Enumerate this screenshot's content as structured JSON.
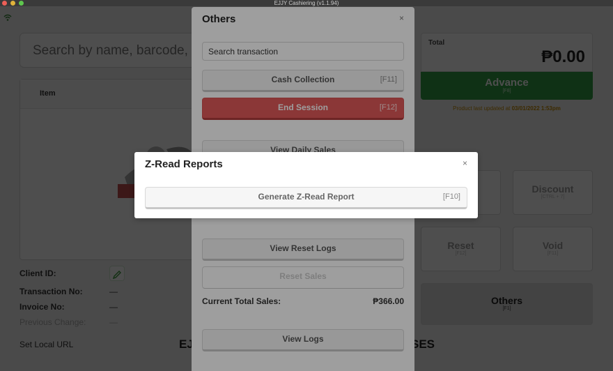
{
  "window": {
    "title": "EJJY Cashiering (v1.1.94)"
  },
  "main": {
    "search_placeholder": "Search by name, barcode, te",
    "table_header_item": "Item",
    "client_id_label": "Client ID:",
    "transaction_no_label": "Transaction No:",
    "transaction_no_value": "—",
    "invoice_no_label": "Invoice No:",
    "invoice_no_value": "—",
    "previous_change_label": "Previous Change:",
    "previous_change_value": "—",
    "set_local_url": "Set Local URL",
    "footer_left": "EJ",
    "footer_right": "SES"
  },
  "right_panel": {
    "total_label": "Total",
    "total_amount": "₱0.00",
    "advance_label": "Advance",
    "advance_shortcut": "[F8]",
    "updated_prefix": "Product last updated at ",
    "updated_at": "03/01/2022 1:53pm",
    "discount_label": "Discount",
    "discount_shortcut": "[CTRL + 7]",
    "reset_label": "Reset",
    "reset_shortcut": "[F12]",
    "void_label": "Void",
    "void_shortcut": "[F11]",
    "others_label": "Others",
    "others_shortcut": "[F1]",
    "accent_green": "#33a044"
  },
  "others_modal": {
    "title": "Others",
    "close": "×",
    "search_value": "Search transaction",
    "cash_collection": "Cash Collection",
    "cash_collection_sc": "[F11]",
    "end_session": "End Session",
    "end_session_sc": "[F12]",
    "view_daily_sales": "View Daily Sales",
    "view_reset_logs": "View Reset Logs",
    "reset_sales": "Reset Sales",
    "current_total_label": "Current Total Sales:",
    "current_total_value": "₱366.00",
    "view_logs": "View Logs",
    "danger_color": "#e05a5a"
  },
  "zread_modal": {
    "title": "Z-Read Reports",
    "close": "×",
    "generate": "Generate Z-Read Report",
    "generate_sc": "[F10]"
  }
}
